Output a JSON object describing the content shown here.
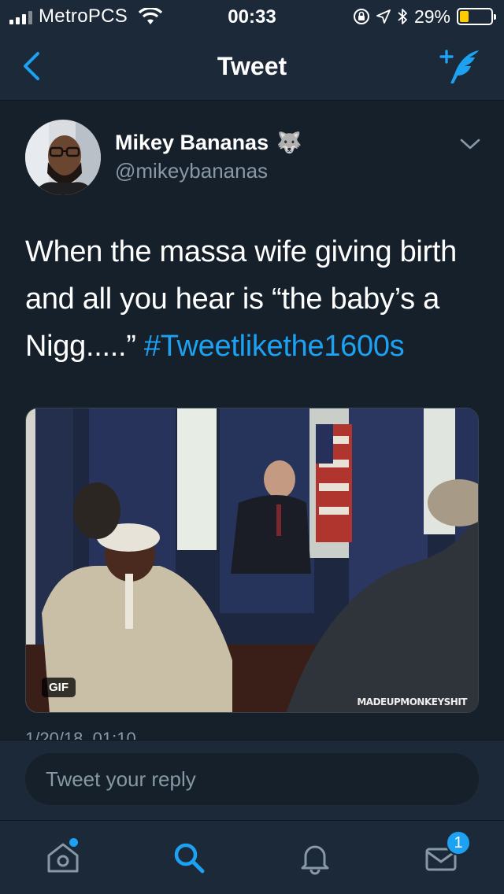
{
  "status_bar": {
    "carrier": "MetroPCS",
    "time": "00:33",
    "battery_percent": "29%",
    "battery_level": 0.29,
    "battery_color": "#ffcc00",
    "icons": [
      "signal-icon",
      "wifi-icon",
      "orientation-lock-icon",
      "location-icon",
      "bluetooth-icon",
      "battery-icon"
    ]
  },
  "nav": {
    "title": "Tweet",
    "back_icon": "chevron-left-icon",
    "compose_icon": "compose-tweet-icon"
  },
  "tweet": {
    "author_name": "Mikey Bananas",
    "author_handle": "@mikeybananas",
    "name_emoji": "🐺",
    "text": "When the massa wife giving birth and all you hear is “the baby’s a Nigg.....” ",
    "hashtag": "#Tweetlikethe1600s",
    "media_badge": "GIF",
    "media_watermark": "MADEUPMONKEYSHIT",
    "timestamp_partial": "1/20/18, 01:10"
  },
  "reply": {
    "placeholder": "Tweet your reply"
  },
  "tab_bar": {
    "tabs": [
      {
        "name": "home",
        "icon": "home-icon",
        "has_dot": true
      },
      {
        "name": "search",
        "icon": "search-icon",
        "active": true
      },
      {
        "name": "notifications",
        "icon": "bell-icon"
      },
      {
        "name": "messages",
        "icon": "envelope-icon",
        "badge": "1"
      }
    ]
  },
  "colors": {
    "background": "#15202b",
    "bar": "#1c2938",
    "accent": "#1da1f2",
    "secondary_text": "#8899a6"
  }
}
